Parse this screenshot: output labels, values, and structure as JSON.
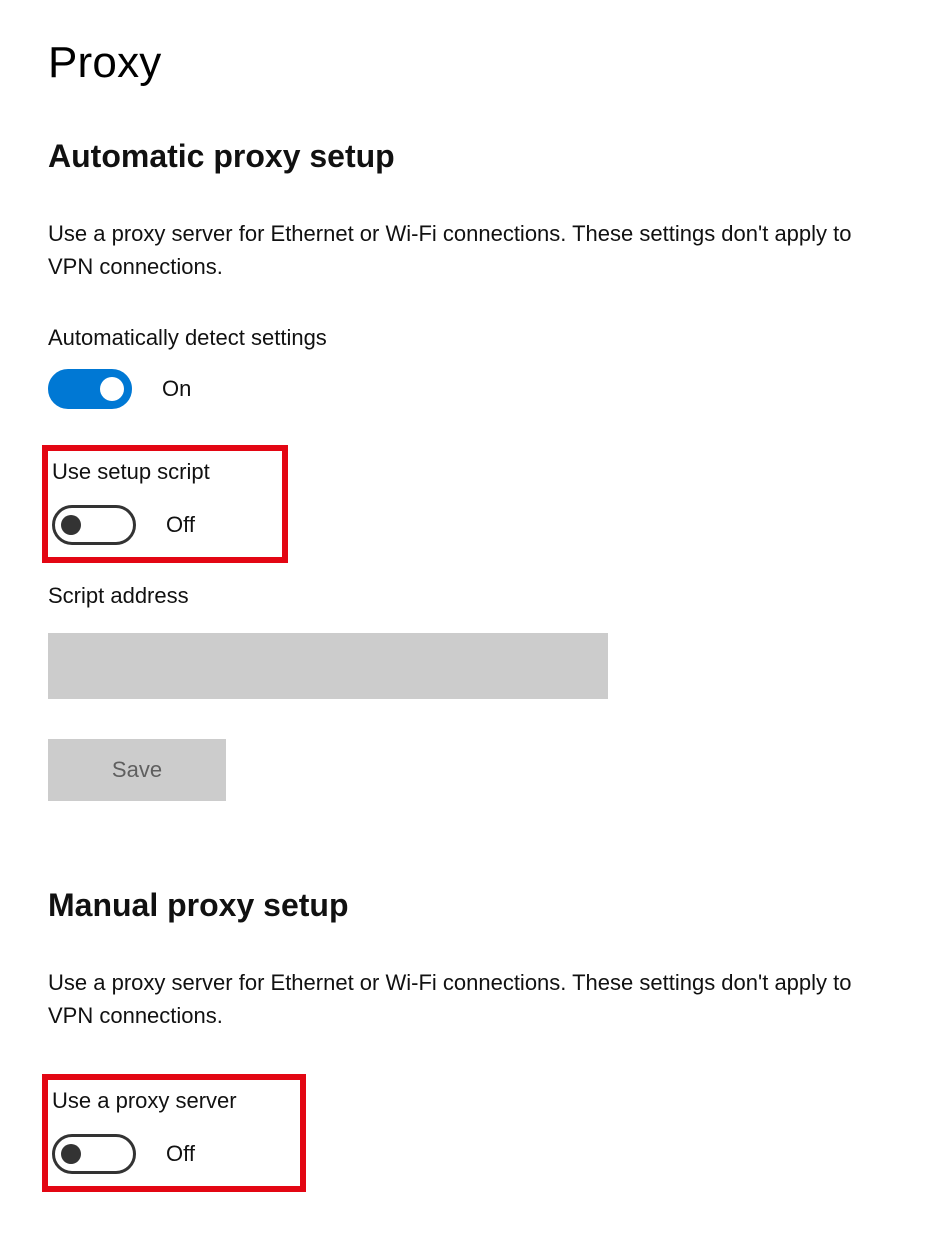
{
  "page": {
    "title": "Proxy"
  },
  "automatic": {
    "heading": "Automatic proxy setup",
    "description": "Use a proxy server for Ethernet or Wi-Fi connections. These settings don't apply to VPN connections.",
    "detect": {
      "label": "Automatically detect settings",
      "state": "On"
    },
    "setup_script": {
      "label": "Use setup script",
      "state": "Off"
    },
    "script_address": {
      "label": "Script address",
      "value": ""
    },
    "save_label": "Save"
  },
  "manual": {
    "heading": "Manual proxy setup",
    "description": "Use a proxy server for Ethernet or Wi-Fi connections. These settings don't apply to VPN connections.",
    "use_proxy": {
      "label": "Use a proxy server",
      "state": "Off"
    }
  },
  "colors": {
    "accent": "#0078d4",
    "highlight": "#e30613",
    "disabled_bg": "#cccccc"
  }
}
